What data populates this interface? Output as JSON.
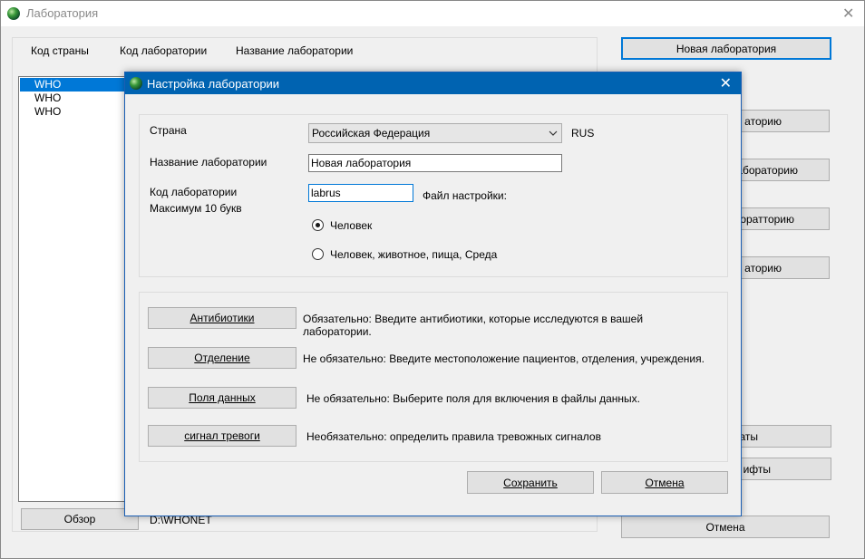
{
  "main_window": {
    "title": "Лаборатория",
    "columns": [
      "Код страны",
      "Код лаборатории",
      "Название лаборатории"
    ],
    "list_items": [
      "WHO",
      "WHO",
      "WHO"
    ],
    "new_lab_button": "Новая лаборатория",
    "right_buttons_partial": [
      "аторию",
      "лабораторию",
      "оратторию",
      "аторию"
    ],
    "lower_buttons_partial": [
      "аты",
      "ифты"
    ],
    "browse_button": "Обзор",
    "path_text": "D:\\WHONET",
    "cancel_button": "Отмена"
  },
  "dialog": {
    "title": "Настройка лаборатории",
    "country_label": "Страна",
    "country_value": "Российская Федерация",
    "country_code": "RUS",
    "lab_name_label": "Название лаборатории",
    "lab_name_value": "Новая лаборатория",
    "lab_code_label": "Код лаборатории",
    "lab_code_hint": "Максимум 10 букв",
    "lab_code_value": "labrus",
    "config_file_label": "Файл настройки:",
    "radio_human": "Человек",
    "radio_all": "Человек, животное, пища, Среда",
    "rows": [
      {
        "button": "Антибиотики",
        "desc": "Обязательно:  Введите антибиотики, которые исследуются в вашей лаборатории."
      },
      {
        "button": "Отделение",
        "desc": "Не обязательно: Введите местоположение пациентов, отделения, учреждения."
      },
      {
        "button": "Поля данных",
        "desc": "Не обязательно: Выберите поля для включения в файлы данных."
      },
      {
        "button": "сигнал тревоги",
        "desc": "Необязательно: определить правила тревожных сигналов"
      }
    ],
    "save_button": "Сохранить",
    "cancel_button": "Отмена"
  },
  "colors": {
    "dialog_title_bg": "#0063b1",
    "selection": "#0078d7",
    "window_bg": "#f0f0f0"
  },
  "icons": {
    "app_icon": "globe-icon",
    "close": "close-icon",
    "dropdown": "chevron-down-icon"
  }
}
